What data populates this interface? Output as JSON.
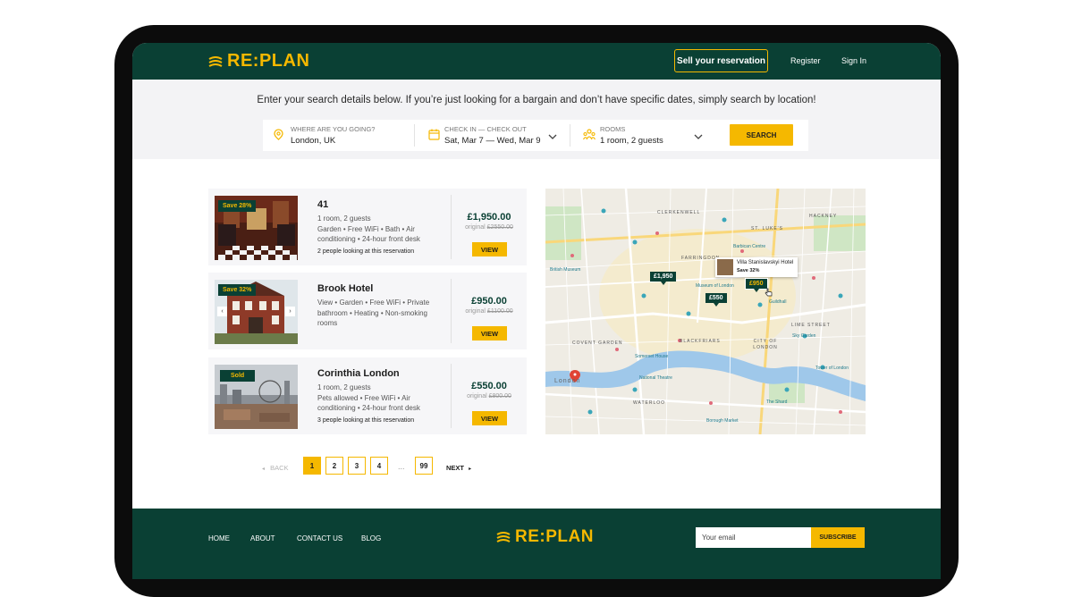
{
  "header": {
    "logo_text": "RE:PLAN",
    "sell_label": "Sell your reservation",
    "register_label": "Register",
    "signin_label": "Sign In"
  },
  "search": {
    "intro": "Enter your search details below. If you’re just looking for a bargain and don’t have specific dates, simply search by location!",
    "destination_label": "WHERE ARE YOU GOING?",
    "destination_value": "London, UK",
    "dates_label": "CHECK IN — CHECK OUT",
    "dates_value": "Sat, Mar 7 — Wed, Mar 9",
    "rooms_label": "ROOMS",
    "rooms_value": "1 room, 2 guests",
    "button_label": "SEARCH"
  },
  "listings": [
    {
      "badge": "Save 28%",
      "name": "41",
      "details": "1 room, 2 guests\nGarden • Free WiFi • Bath • Air conditioning • 24-hour front desk",
      "watching": "2 people looking at this reservation",
      "price": "£1,950.00",
      "original_prefix": "original",
      "original_price": "£2550.00",
      "view_label": "VIEW"
    },
    {
      "badge": "Save 32%",
      "name": "Brook Hotel",
      "details": "View • Garden • Free WiFi • Private bathroom • Heating • Non-smoking rooms",
      "watching": "",
      "price": "£950.00",
      "original_prefix": "original",
      "original_price": "£1100.00",
      "view_label": "VIEW"
    },
    {
      "badge": "Sold",
      "name": "Corinthia London",
      "details": "1 room, 2 guests\nPets allowed • Free WiFi • Air conditioning • 24-hour front desk",
      "watching": "3 people looking at this reservation",
      "price": "£550.00",
      "original_prefix": "original",
      "original_price": "£800.00",
      "view_label": "VIEW"
    }
  ],
  "map": {
    "pins": [
      "£1,950",
      "£550",
      "£950"
    ],
    "popup_name": "Villa Stanislavskyi Hotel",
    "popup_save": "Save 32%",
    "areas": [
      "CLERKENWELL",
      "FARRINGDON",
      "HACKNEY",
      "ST. LUKE'S",
      "CITY OF LONDON",
      "COVENT GARDEN",
      "BLACKFRIARS",
      "WATERLOO",
      "LIME STREET",
      "London"
    ],
    "pois": [
      "Sky Garden",
      "Tower of London",
      "The Shard",
      "National Theatre",
      "Museum of London",
      "Somerset House",
      "British Museum",
      "Guildhall",
      "Barbican Centre",
      "Borough Market"
    ]
  },
  "pagination": {
    "back": "BACK",
    "pages": [
      "1",
      "2",
      "3",
      "4"
    ],
    "ellipsis": "...",
    "last": "99",
    "next": "NEXT",
    "current_page": 1
  },
  "footer": {
    "links": [
      "HOME",
      "ABOUT",
      "CONTACT US",
      "BLOG"
    ],
    "logo_text": "RE:PLAN",
    "email_placeholder": "Your email",
    "subscribe_label": "SUBSCRIBE"
  },
  "colors": {
    "brand_dark": "#0a4034",
    "accent": "#f5b800",
    "surface": "#f3f3f5"
  }
}
